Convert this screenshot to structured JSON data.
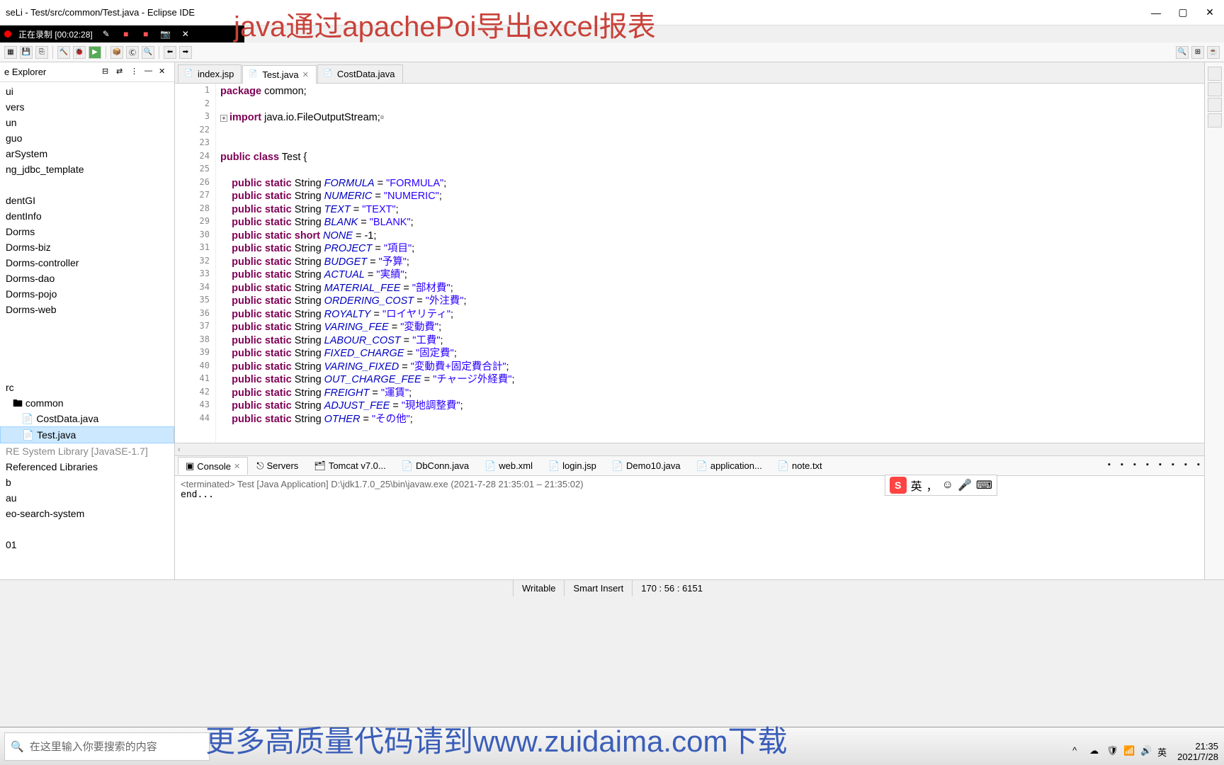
{
  "window": {
    "title": "seLi - Test/src/common/Test.java - Eclipse IDE",
    "overlay_title": "java通过apachePoi导出excel报表"
  },
  "recording": {
    "status": "正在录制 [00:02:28]"
  },
  "sidebar": {
    "title": "e Explorer",
    "items": [
      {
        "label": "ui",
        "indent": 0
      },
      {
        "label": "vers",
        "indent": 0
      },
      {
        "label": "un",
        "indent": 0
      },
      {
        "label": "guo",
        "indent": 0
      },
      {
        "label": "arSystem",
        "indent": 0
      },
      {
        "label": "ng_jdbc_template",
        "indent": 0
      },
      {
        "label": "",
        "indent": 0,
        "blank": true
      },
      {
        "label": "dentGI",
        "indent": 0
      },
      {
        "label": "dentInfo",
        "indent": 0
      },
      {
        "label": "Dorms",
        "indent": 0
      },
      {
        "label": "Dorms-biz",
        "indent": 0
      },
      {
        "label": "Dorms-controller",
        "indent": 0
      },
      {
        "label": "Dorms-dao",
        "indent": 0
      },
      {
        "label": "Dorms-pojo",
        "indent": 0
      },
      {
        "label": "Dorms-web",
        "indent": 0
      },
      {
        "label": "",
        "indent": 0,
        "blank": true
      },
      {
        "label": "",
        "indent": 0,
        "blank": true
      },
      {
        "label": "",
        "indent": 0,
        "blank": true
      },
      {
        "label": "",
        "indent": 0,
        "blank": true
      },
      {
        "label": "rc",
        "indent": 0
      },
      {
        "label": "🖿 common",
        "indent": 1
      },
      {
        "label": "📄 CostData.java",
        "indent": 2
      },
      {
        "label": "📄 Test.java",
        "indent": 2,
        "selected": true
      },
      {
        "label": "RE System Library [JavaSE-1.7]",
        "indent": 0,
        "lib": true
      },
      {
        "label": "Referenced Libraries",
        "indent": 0
      },
      {
        "label": "b",
        "indent": 0
      },
      {
        "label": "au",
        "indent": 0
      },
      {
        "label": "eo-search-system",
        "indent": 0
      },
      {
        "label": "",
        "indent": 0,
        "blank": true
      },
      {
        "label": "01",
        "indent": 0
      }
    ]
  },
  "tabs": [
    {
      "label": "index.jsp",
      "active": false,
      "icon": "📄"
    },
    {
      "label": "Test.java",
      "active": true,
      "icon": "📄",
      "close": true
    },
    {
      "label": "CostData.java",
      "active": false,
      "icon": "📄"
    }
  ],
  "code": {
    "lines": [
      {
        "n": 1,
        "html": "<span class='kw'>package</span> common;"
      },
      {
        "n": 2,
        "html": ""
      },
      {
        "n": 3,
        "html": "<span class='fold'>+</span><span class='kw'>import</span> java.io.FileOutputStream;▫"
      },
      {
        "n": 22,
        "html": ""
      },
      {
        "n": 23,
        "html": ""
      },
      {
        "n": 24,
        "html": "<span class='kw'>public class</span> Test {"
      },
      {
        "n": 25,
        "html": ""
      },
      {
        "n": 26,
        "html": "    <span class='kw'>public static</span> String <span class='var-it'>FORMULA</span> = <span class='str'>\"FORMULA\"</span>;"
      },
      {
        "n": 27,
        "html": "    <span class='kw'>public static</span> String <span class='var-it'>NUMERIC</span> = <span class='str'>\"NUMERIC\"</span>;"
      },
      {
        "n": 28,
        "html": "    <span class='kw'>public static</span> String <span class='var-it'>TEXT</span> = <span class='str'>\"TEXT\"</span>;"
      },
      {
        "n": 29,
        "html": "    <span class='kw'>public static</span> String <span class='var-it'>BLANK</span> = <span class='str'>\"BLANK\"</span>;"
      },
      {
        "n": 30,
        "html": "    <span class='kw'>public static short</span> <span class='var-it'>NONE</span> = -1;"
      },
      {
        "n": 31,
        "html": "    <span class='kw'>public static</span> String <span class='var-it'>PROJECT</span> = <span class='str'>\"項目\"</span>;"
      },
      {
        "n": 32,
        "html": "    <span class='kw'>public static</span> String <span class='var-it'>BUDGET</span> = <span class='str'>\"予算\"</span>;"
      },
      {
        "n": 33,
        "html": "    <span class='kw'>public static</span> String <span class='var-it'>ACTUAL</span> = <span class='str'>\"実績\"</span>;"
      },
      {
        "n": 34,
        "html": "    <span class='kw'>public static</span> String <span class='var-it'>MATERIAL_FEE</span> = <span class='str'>\"部材費\"</span>;"
      },
      {
        "n": 35,
        "html": "    <span class='kw'>public static</span> String <span class='var-it'>ORDERING_COST</span> = <span class='str'>\"外注費\"</span>;"
      },
      {
        "n": 36,
        "html": "    <span class='kw'>public static</span> String <span class='var-it'>ROYALTY</span> = <span class='str'>\"ロイヤリティ\"</span>;"
      },
      {
        "n": 37,
        "html": "    <span class='kw'>public static</span> String <span class='var-it'>VARING_FEE</span> = <span class='str'>\"変動費\"</span>;"
      },
      {
        "n": 38,
        "html": "    <span class='kw'>public static</span> String <span class='var-it'>LABOUR_COST</span> = <span class='str'>\"工費\"</span>;"
      },
      {
        "n": 39,
        "html": "    <span class='kw'>public static</span> String <span class='var-it'>FIXED_CHARGE</span> = <span class='str'>\"固定費\"</span>;"
      },
      {
        "n": 40,
        "html": "    <span class='kw'>public static</span> String <span class='var-it'>VARING_FIXED</span> = <span class='str'>\"変動費+固定費合計\"</span>;"
      },
      {
        "n": 41,
        "html": "    <span class='kw'>public static</span> String <span class='var-it'>OUT_CHARGE_FEE</span> = <span class='str'>\"チャージ外経費\"</span>;"
      },
      {
        "n": 42,
        "html": "    <span class='kw'>public static</span> String <span class='var-it'>FREIGHT</span> = <span class='str'>\"運賃\"</span>;"
      },
      {
        "n": 43,
        "html": "    <span class='kw'>public static</span> String <span class='var-it'>ADJUST_FEE</span> = <span class='str'>\"現地調整費\"</span>;"
      },
      {
        "n": 44,
        "html": "    <span class='kw'>public static</span> String <span class='var-it'>OTHER</span> = <span class='str'>\"その他\"</span>;"
      }
    ]
  },
  "console": {
    "tabs": [
      {
        "label": "Console",
        "active": true,
        "icon": "▣"
      },
      {
        "label": "Servers",
        "icon": "⎋"
      },
      {
        "label": "Tomcat v7.0...",
        "icon": "🗂"
      },
      {
        "label": "DbConn.java",
        "icon": "📄"
      },
      {
        "label": "web.xml",
        "icon": "📄"
      },
      {
        "label": "login.jsp",
        "icon": "📄"
      },
      {
        "label": "Demo10.java",
        "icon": "📄"
      },
      {
        "label": "application...",
        "icon": "📄"
      },
      {
        "label": "note.txt",
        "icon": "📄"
      }
    ],
    "terminated": "<terminated> Test [Java Application] D:\\jdk1.7.0_25\\bin\\javaw.exe  (2021-7-28 21:35:01 – 21:35:02)",
    "output": "end..."
  },
  "status": {
    "writable": "Writable",
    "insert": "Smart Insert",
    "cursor": "170 : 56 : 6151"
  },
  "taskbar": {
    "search_placeholder": "在这里输入你要搜索的内容",
    "banner": "更多高质量代码请到www.zuidaima.com下载",
    "time": "21:35",
    "date": "2021/7/28",
    "ime": "英"
  },
  "ime_float": {
    "lang": "英"
  }
}
